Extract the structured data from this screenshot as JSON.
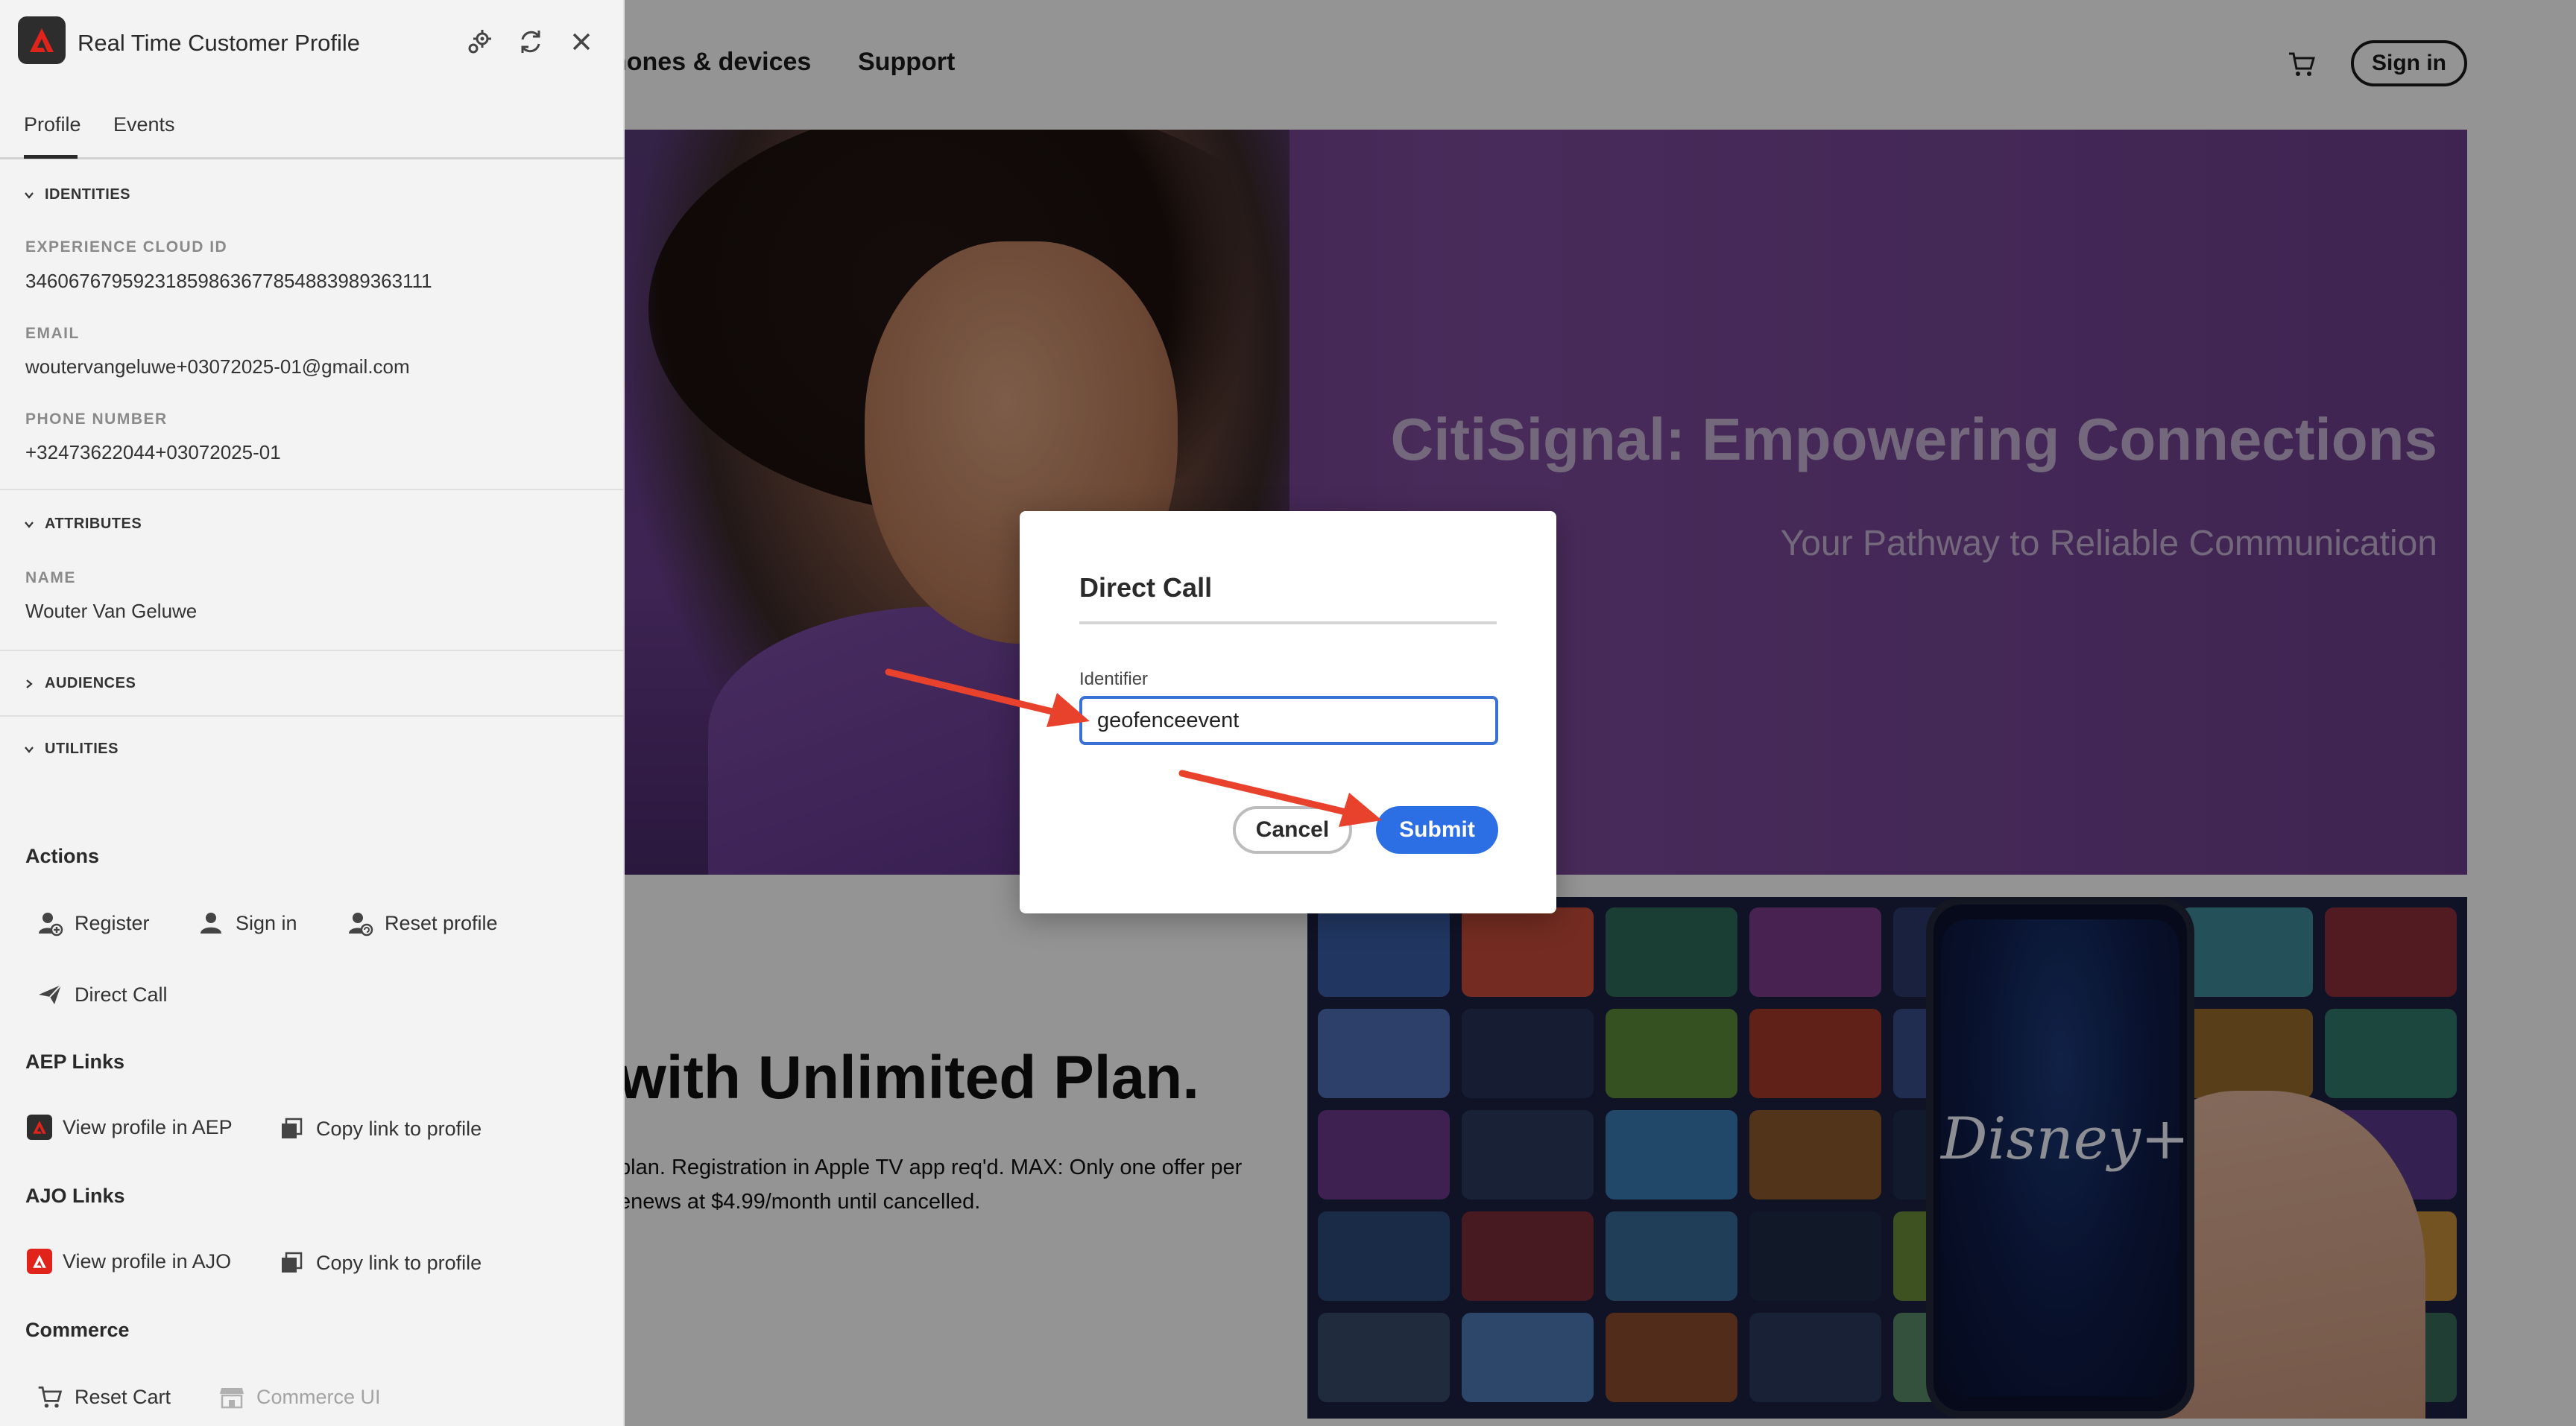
{
  "site": {
    "nav": [
      {
        "label": "hones & devices"
      },
      {
        "label": "Support"
      }
    ],
    "signin_label": "Sign in",
    "hero_title": "CitiSignal: Empowering Connections",
    "hero_subtitle": "Your Pathway to Reliable Communication",
    "promo_title": "with Unlimited Plan.",
    "promo_line1": "plan. Registration in Apple TV app req'd. MAX: Only one offer per",
    "promo_line2": "enews at $4.99/month until cancelled.",
    "streaming_logo": "Disney+"
  },
  "panel": {
    "title": "Real Time Customer Profile",
    "tabs": [
      {
        "label": "Profile",
        "active": true
      },
      {
        "label": "Events",
        "active": false
      }
    ],
    "sections": {
      "identities": "IDENTITIES",
      "attributes": "ATTRIBUTES",
      "audiences": "AUDIENCES",
      "utilities": "UTILITIES"
    },
    "identities": [
      {
        "label": "EXPERIENCE CLOUD ID",
        "value": "34606767959231859863677854883989363111"
      },
      {
        "label": "EMAIL",
        "value": "woutervangeluwe+03072025-01@gmail.com"
      },
      {
        "label": "PHONE NUMBER",
        "value": "+32473622044+03072025-01"
      }
    ],
    "attributes": [
      {
        "label": "NAME",
        "value": "Wouter Van Geluwe"
      }
    ],
    "actions_title": "Actions",
    "actions": [
      {
        "label": "Register",
        "icon": "user-add-icon"
      },
      {
        "label": "Sign in",
        "icon": "user-icon"
      },
      {
        "label": "Reset profile",
        "icon": "user-reset-icon"
      },
      {
        "label": "Direct Call",
        "icon": "send-icon"
      }
    ],
    "aep_title": "AEP Links",
    "aep_links": [
      {
        "label": "View profile in AEP",
        "icon": "adobe-icon"
      },
      {
        "label": "Copy link to profile",
        "icon": "copy-icon"
      }
    ],
    "ajo_title": "AJO Links",
    "ajo_links": [
      {
        "label": "View profile in AJO",
        "icon": "adobe-icon"
      },
      {
        "label": "Copy link to profile",
        "icon": "copy-icon"
      }
    ],
    "commerce_title": "Commerce",
    "commerce": [
      {
        "label": "Reset Cart",
        "icon": "cart-icon",
        "enabled": true
      },
      {
        "label": "Commerce UI",
        "icon": "store-icon",
        "enabled": false
      }
    ]
  },
  "dialog": {
    "title": "Direct Call",
    "field_label": "Identifier",
    "field_value": "geofenceevent",
    "cancel_label": "Cancel",
    "submit_label": "Submit"
  },
  "colors": {
    "accent_blue": "#2c6ee3",
    "annotation_red": "#e8412c",
    "hero_purple": "#6d3f8e",
    "adobe_red": "#e0231b"
  }
}
